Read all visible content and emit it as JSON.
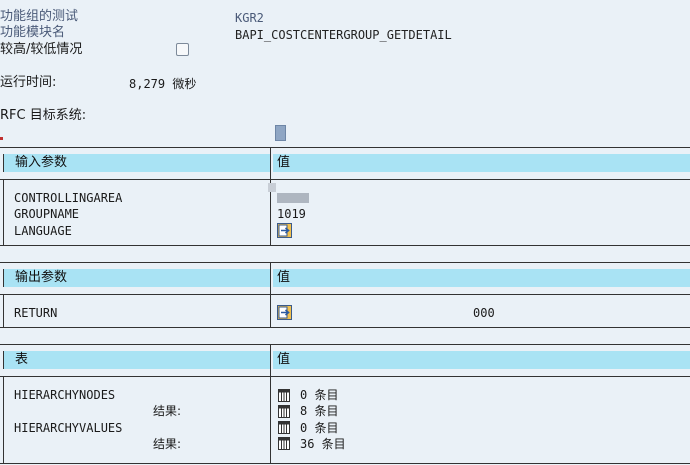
{
  "header": {
    "function_group_label": "功能组的测试",
    "function_group_value": "KGR2",
    "function_module_label": "功能模块名",
    "function_module_value": "BAPI_COSTCENTERGROUP_GETDETAIL",
    "upper_lower_label": "较高/较低情况",
    "runtime_label": "运行时间:",
    "runtime_value": "8,279 微秒",
    "rfc_label": "RFC 目标系统:"
  },
  "import": {
    "title": "输入参数",
    "value_title": "值",
    "rows": [
      {
        "name": "CONTROLLINGAREA",
        "value": ""
      },
      {
        "name": "GROUPNAME",
        "value": "1019"
      },
      {
        "name": "LANGUAGE",
        "value": ""
      }
    ]
  },
  "export": {
    "title": "输出参数",
    "value_title": "值",
    "rows": [
      {
        "name": "RETURN",
        "value": "000"
      }
    ]
  },
  "tables": {
    "title": "表",
    "value_title": "值",
    "result_label": "结果:",
    "rows": [
      {
        "name": "HIERARCHYNODES",
        "input": "0 条目",
        "result": "8 条目"
      },
      {
        "name": "HIERARCHYVALUES",
        "input": "0 条目",
        "result": "36 条目"
      }
    ]
  },
  "colors": {
    "background": "#eaf1f7",
    "section_header": "#a9e3f4",
    "header_text": "#4a5a78"
  }
}
